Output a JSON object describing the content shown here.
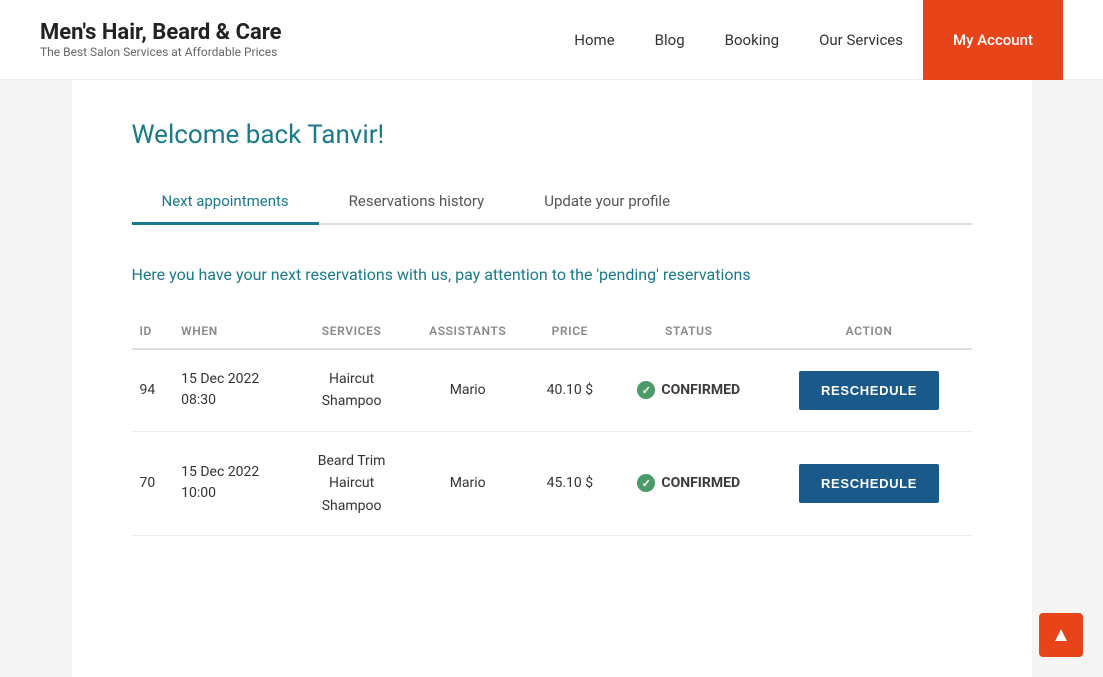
{
  "brand": {
    "name": "Men's Hair, Beard & Care",
    "tagline": "The Best Salon Services at Affordable Prices"
  },
  "nav": {
    "items": [
      {
        "label": "Home",
        "id": "home"
      },
      {
        "label": "Blog",
        "id": "blog"
      },
      {
        "label": "Booking",
        "id": "booking"
      },
      {
        "label": "Our Services",
        "id": "our-services"
      },
      {
        "label": "My Account",
        "id": "my-account",
        "accent": true
      }
    ]
  },
  "page": {
    "welcome": "Welcome back Tanvir!"
  },
  "tabs": [
    {
      "label": "Next appointments",
      "id": "next-appointments",
      "active": true
    },
    {
      "label": "Reservations history",
      "id": "reservations-history",
      "active": false
    },
    {
      "label": "Update your profile",
      "id": "update-profile",
      "active": false
    }
  ],
  "info_text": "Here you have your next reservations with us, pay attention to the 'pending' reservations",
  "table": {
    "columns": [
      "ID",
      "WHEN",
      "SERVICES",
      "ASSISTANTS",
      "PRICE",
      "STATUS",
      "ACTION"
    ],
    "rows": [
      {
        "id": "94",
        "when_date": "15 Dec 2022",
        "when_time": "08:30",
        "services": [
          "Haircut",
          "Shampoo"
        ],
        "assistants": "Mario",
        "price": "40.10 $",
        "status": "CONFIRMED",
        "action": "RESCHEDULE"
      },
      {
        "id": "70",
        "when_date": "15 Dec 2022",
        "when_time": "10:00",
        "services": [
          "Beard Trim",
          "Haircut",
          "Shampoo"
        ],
        "assistants": "Mario",
        "price": "45.10 $",
        "status": "CONFIRMED",
        "action": "RESCHEDULE"
      }
    ]
  },
  "scroll_top_icon": "▲"
}
